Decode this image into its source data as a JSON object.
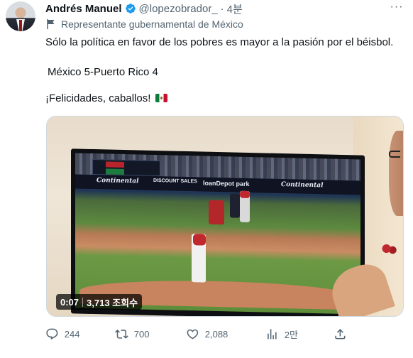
{
  "author": {
    "name": "Andrés Manuel",
    "handle": "@lopezobrador_",
    "separator": "·",
    "time": "4분",
    "affiliation": "Representante gubernamental de México",
    "more_label": "···"
  },
  "tweet": {
    "line1": "Sólo la política en favor de los pobres es mayor a la pasión por el béisbol.",
    "line2": "México 5-Puerto Rico 4",
    "line3": "¡Felicidades, caballos!"
  },
  "video": {
    "elapsed": "0:07",
    "views": "3,713 조회수",
    "billboards": [
      "Continental",
      "DISCOUNT SALES",
      "loanDepot park",
      "Continental"
    ]
  },
  "actions": {
    "replies": "244",
    "retweets": "700",
    "likes": "2,088",
    "views": "2만"
  },
  "colors": {
    "text": "#0f1419",
    "secondary": "#536471",
    "verified": "#1d9bf0",
    "border": "#cfd9de"
  }
}
